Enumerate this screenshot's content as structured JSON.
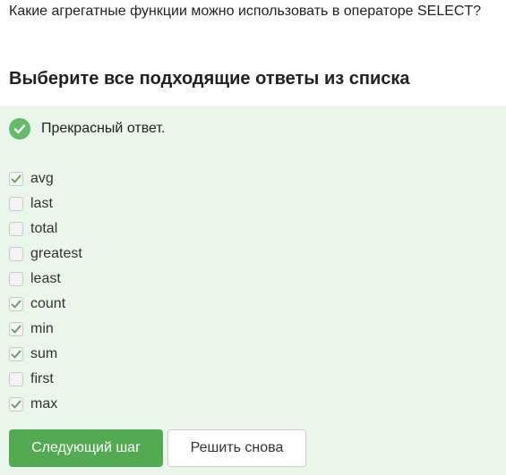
{
  "question": {
    "text": "Какие агрегатные функции можно использовать в операторе SELECT?"
  },
  "instructions": {
    "text": "Выберите все подходящие ответы из списка"
  },
  "feedback": {
    "text": "Прекрасный ответ.",
    "icon": "check-circle-icon",
    "color": "#66bb6a"
  },
  "options": [
    {
      "label": "avg",
      "checked": true
    },
    {
      "label": "last",
      "checked": false
    },
    {
      "label": "total",
      "checked": false
    },
    {
      "label": "greatest",
      "checked": false
    },
    {
      "label": "least",
      "checked": false
    },
    {
      "label": "count",
      "checked": true
    },
    {
      "label": "min",
      "checked": true
    },
    {
      "label": "sum",
      "checked": true
    },
    {
      "label": "first",
      "checked": false
    },
    {
      "label": "max",
      "checked": true
    }
  ],
  "actions": {
    "next_label": "Следующий шаг",
    "retry_label": "Решить снова"
  },
  "colors": {
    "accent": "#54a953",
    "panel_bg": "#e9f6e9"
  }
}
